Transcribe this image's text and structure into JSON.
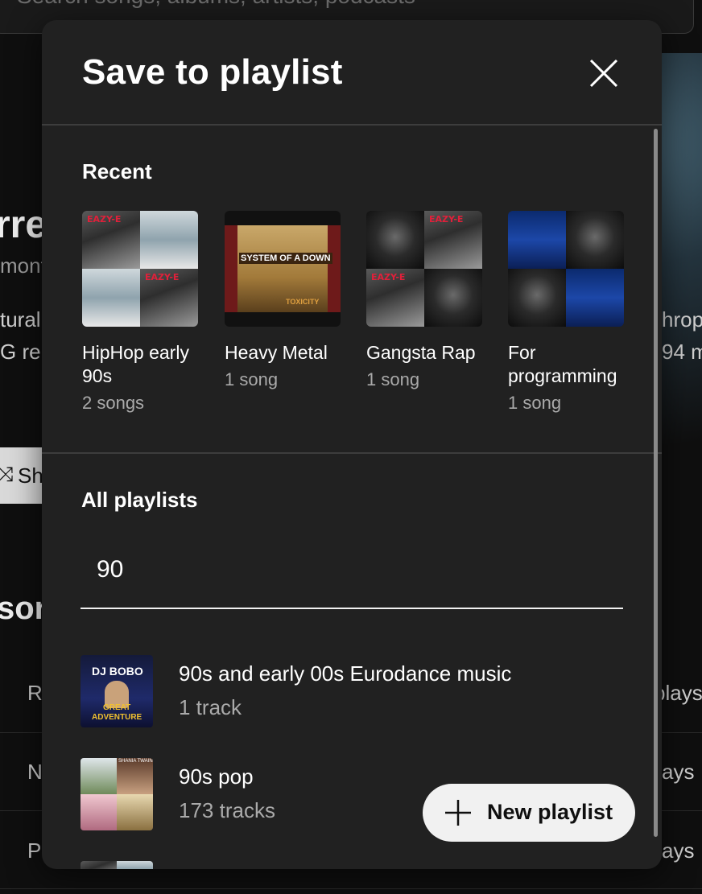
{
  "background": {
    "search_placeholder": "Search songs, albums, artists, podcasts",
    "title_fragment": "rre",
    "subtitle_fragment": "mont",
    "desc_line1": "tural",
    "desc_line2": "G re",
    "right_line1": "hrop",
    "right_line2": "94 m",
    "shuffle_label": "Sh",
    "section_fragment": "sor",
    "rows": [
      {
        "left": "R",
        "right": "plays"
      },
      {
        "left": "N",
        "right": "ays"
      },
      {
        "left": "P",
        "right": "ays"
      }
    ]
  },
  "dialog": {
    "title": "Save to playlist",
    "recent_title": "Recent",
    "all_title": "All playlists",
    "search_value": "90",
    "new_playlist_label": "New playlist",
    "recent": [
      {
        "name": "HipHop early 90s",
        "count": "2 songs"
      },
      {
        "name": "Heavy Metal",
        "count": "1 song"
      },
      {
        "name": "Gangsta Rap",
        "count": "1 song"
      },
      {
        "name": "For programming",
        "count": "1 song"
      }
    ],
    "playlists": [
      {
        "name": "90s and early 00s Eurodance music",
        "count": "1 track"
      },
      {
        "name": "90s pop",
        "count": "173 tracks"
      }
    ],
    "art_text": {
      "eazy": "EAZY-E",
      "soad": "SYSTEM OF A DOWN",
      "toxicity": "TOXICITY",
      "djbobo": "DJ BOBO",
      "great": "GREAT",
      "adventure": "ADVENTURE",
      "shania": "SHANIA TWAIN"
    }
  },
  "colors": {
    "dialog_bg": "#212121",
    "page_bg": "#0f0f0f",
    "secondary_text": "#aaaaaa",
    "button_bg": "#f1f1f1"
  },
  "icons": {
    "close": "close-icon",
    "add": "plus-icon"
  }
}
